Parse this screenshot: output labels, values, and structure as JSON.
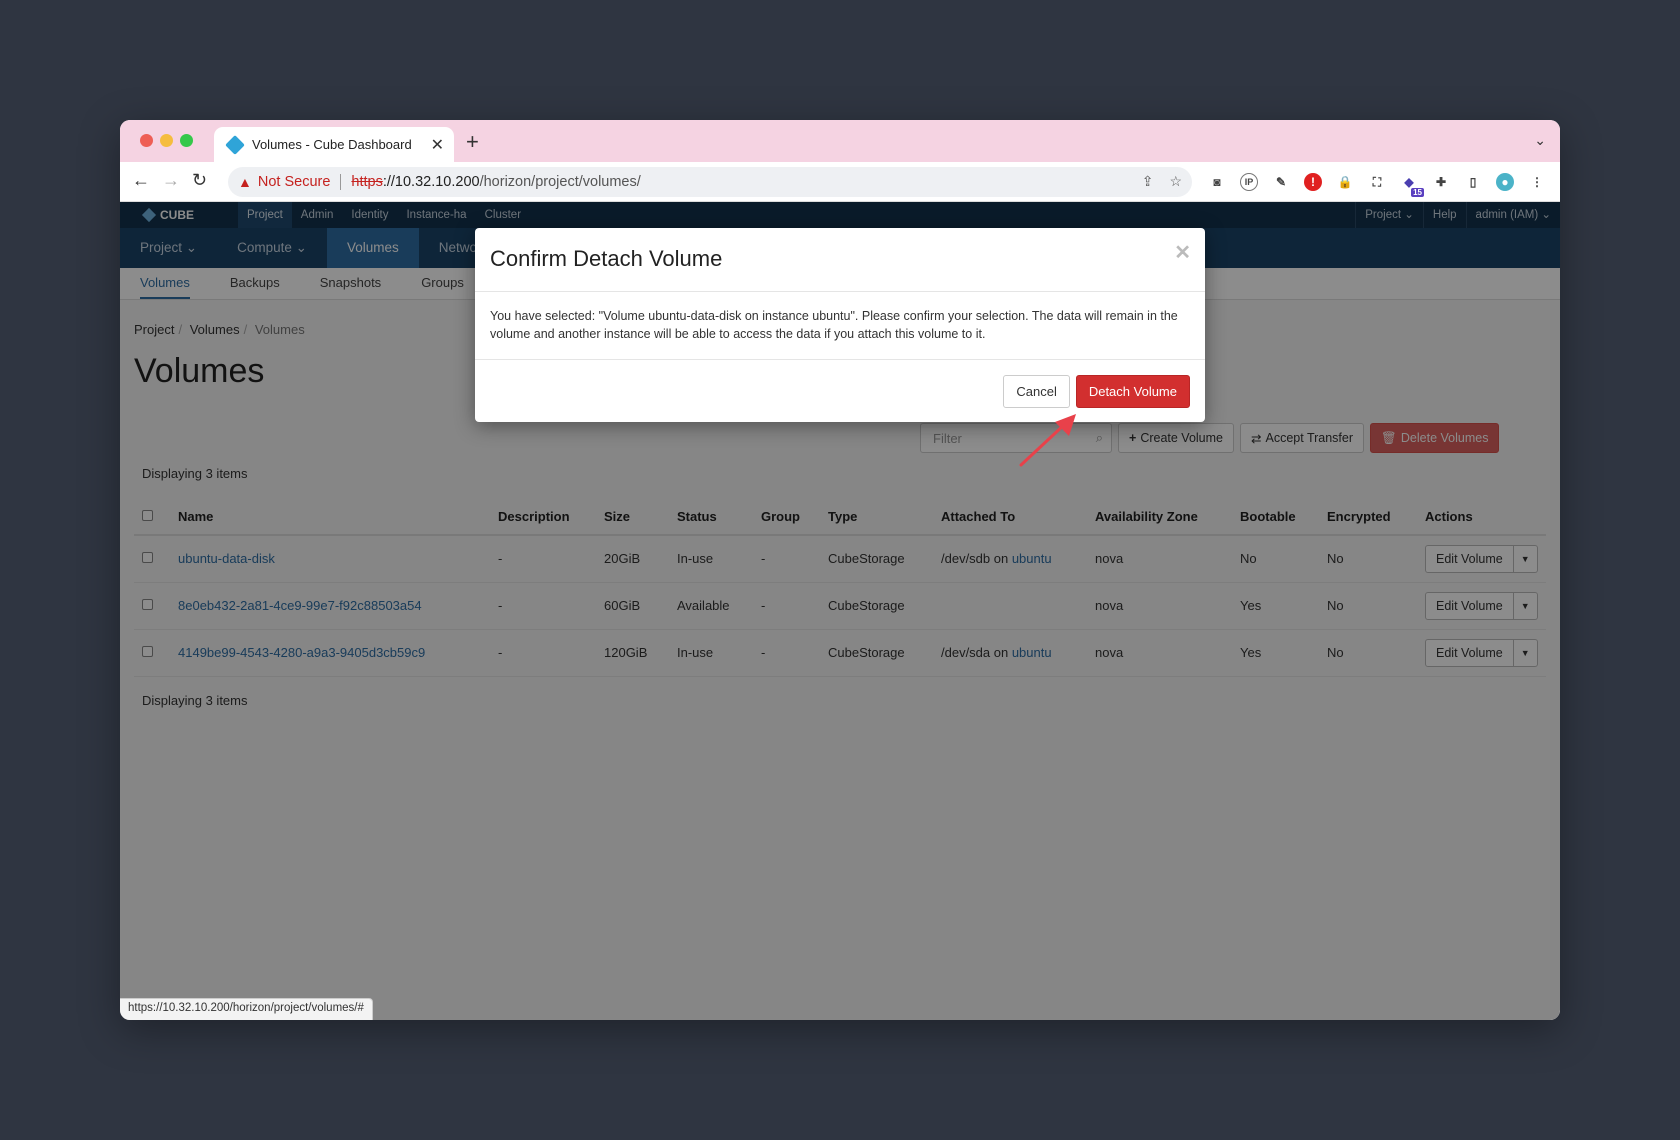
{
  "browser": {
    "tab_title": "Volumes - Cube Dashboard",
    "new_tab": "+",
    "not_secure": "Not Secure",
    "url_scheme": "https",
    "url_host": "://10.32.10.200",
    "url_path": "/horizon/project/volumes/",
    "status_url": "https://10.32.10.200/horizon/project/volumes/#",
    "extension_badge": "15"
  },
  "topnav": {
    "brand": "CUBE",
    "items": [
      "Project",
      "Admin",
      "Identity",
      "Instance-ha",
      "Cluster"
    ],
    "right": [
      "Project ⌄",
      "Help",
      "admin (IAM) ⌄"
    ]
  },
  "secnav": {
    "items": [
      "Project ⌄",
      "Compute ⌄",
      "Volumes",
      "Netwo"
    ]
  },
  "subnav": {
    "items": [
      "Volumes",
      "Backups",
      "Snapshots",
      "Groups"
    ]
  },
  "breadcrumb": [
    "Project",
    "Volumes",
    "Volumes"
  ],
  "page_title": "Volumes",
  "filter_placeholder": "Filter",
  "actions": {
    "create": "Create Volume",
    "accept": "Accept Transfer",
    "delete": "Delete Volumes"
  },
  "count_text": "Displaying 3 items",
  "table": {
    "headers": [
      "Name",
      "Description",
      "Size",
      "Status",
      "Group",
      "Type",
      "Attached To",
      "Availability Zone",
      "Bootable",
      "Encrypted",
      "Actions"
    ],
    "rows": [
      {
        "name": "ubuntu-data-disk",
        "description": "-",
        "size": "20GiB",
        "status": "In-use",
        "group": "-",
        "type": "CubeStorage",
        "attached_dev": "/dev/sdb on ",
        "attached_inst": "ubuntu",
        "zone": "nova",
        "bootable": "No",
        "encrypted": "No",
        "action": "Edit Volume"
      },
      {
        "name": "8e0eb432-2a81-4ce9-99e7-f92c88503a54",
        "description": "-",
        "size": "60GiB",
        "status": "Available",
        "group": "-",
        "type": "CubeStorage",
        "attached_dev": "",
        "attached_inst": "",
        "zone": "nova",
        "bootable": "Yes",
        "encrypted": "No",
        "action": "Edit Volume"
      },
      {
        "name": "4149be99-4543-4280-a9a3-9405d3cb59c9",
        "description": "-",
        "size": "120GiB",
        "status": "In-use",
        "group": "-",
        "type": "CubeStorage",
        "attached_dev": "/dev/sda on ",
        "attached_inst": "ubuntu",
        "zone": "nova",
        "bootable": "Yes",
        "encrypted": "No",
        "action": "Edit Volume"
      }
    ]
  },
  "modal": {
    "title": "Confirm Detach Volume",
    "body": "You have selected: \"Volume ubuntu-data-disk on instance ubuntu\". Please confirm your selection. The data will remain in the volume and another instance will be able to access the data if you attach this volume to it.",
    "cancel": "Cancel",
    "confirm": "Detach Volume"
  },
  "colors": {
    "accent": "#2e6da4",
    "danger": "#d22f2f",
    "nav": "#13324d",
    "arrow": "#e8414a"
  }
}
